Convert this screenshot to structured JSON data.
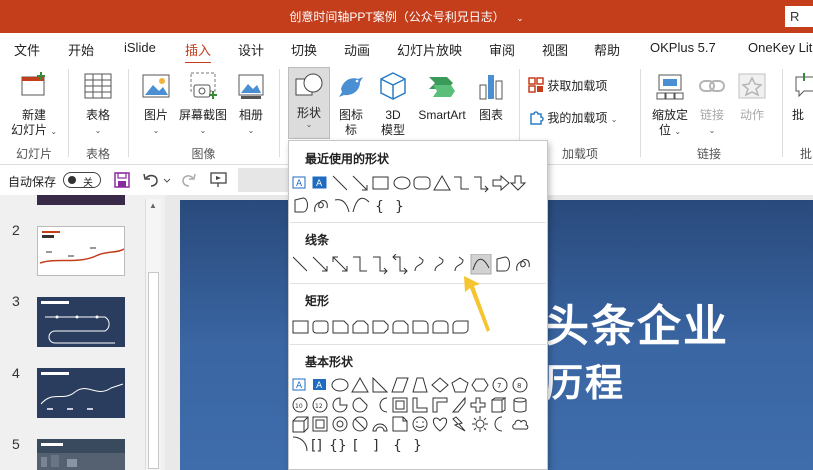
{
  "window": {
    "title": "创意时间轴PPT案例（公众号利兄日志）",
    "title_dropdown": "⌄",
    "account_box": "R"
  },
  "tabs": [
    {
      "label": "文件"
    },
    {
      "label": "开始"
    },
    {
      "label": "iSlide"
    },
    {
      "label": "插入",
      "active": true
    },
    {
      "label": "设计"
    },
    {
      "label": "切换"
    },
    {
      "label": "动画"
    },
    {
      "label": "幻灯片放映"
    },
    {
      "label": "审阅"
    },
    {
      "label": "视图"
    },
    {
      "label": "帮助"
    },
    {
      "label": "OKPlus 5.7"
    },
    {
      "label": "OneKey Lit"
    }
  ],
  "ribbon": {
    "new_slide": {
      "line1": "新建",
      "line2": "幻灯片",
      "caret": "⌄"
    },
    "table": {
      "label": "表格",
      "caret": "⌄"
    },
    "picture": {
      "label": "图片",
      "caret": "⌄"
    },
    "screenshot": {
      "label": "屏幕截图",
      "caret": "⌄"
    },
    "album": {
      "label": "相册",
      "caret": "⌄"
    },
    "shapes": {
      "label": "形状",
      "caret": "⌄"
    },
    "icons": {
      "label": "图标"
    },
    "icons_line2": "标",
    "model3d": {
      "line1": "3D",
      "line2": "模型"
    },
    "smartart": {
      "label": "SmartArt"
    },
    "chart": {
      "label": "图表"
    },
    "get_addins": {
      "label": "获取加载项"
    },
    "my_addins": {
      "label": "我的加载项",
      "caret": "⌄"
    },
    "zoom": {
      "line1": "缩放定",
      "line2": "位",
      "caret": "⌄"
    },
    "link": {
      "label": "链接",
      "caret": "⌄"
    },
    "action": {
      "label": "动作"
    },
    "comment": {
      "label": "批"
    },
    "groups": {
      "slides": "幻灯片",
      "tables": "表格",
      "images": "图像",
      "addins": "加载项",
      "links": "链接",
      "comments": "批"
    }
  },
  "qat": {
    "autosave_label": "自动保存",
    "toggle_state": "关"
  },
  "slides_pane": {
    "numbers": [
      "2",
      "3",
      "4",
      "5"
    ]
  },
  "slide": {
    "line1": "头条企业",
    "line2": "历程"
  },
  "shapes_menu": {
    "recent": "最近使用的形状",
    "lines": "线条",
    "rectangles": "矩形",
    "basic": "基本形状",
    "selected_shape": "curve-line"
  },
  "colors": {
    "accent": "#c43e1c",
    "arrow": "#f5c431",
    "slide_bg": "#2d4e82"
  }
}
